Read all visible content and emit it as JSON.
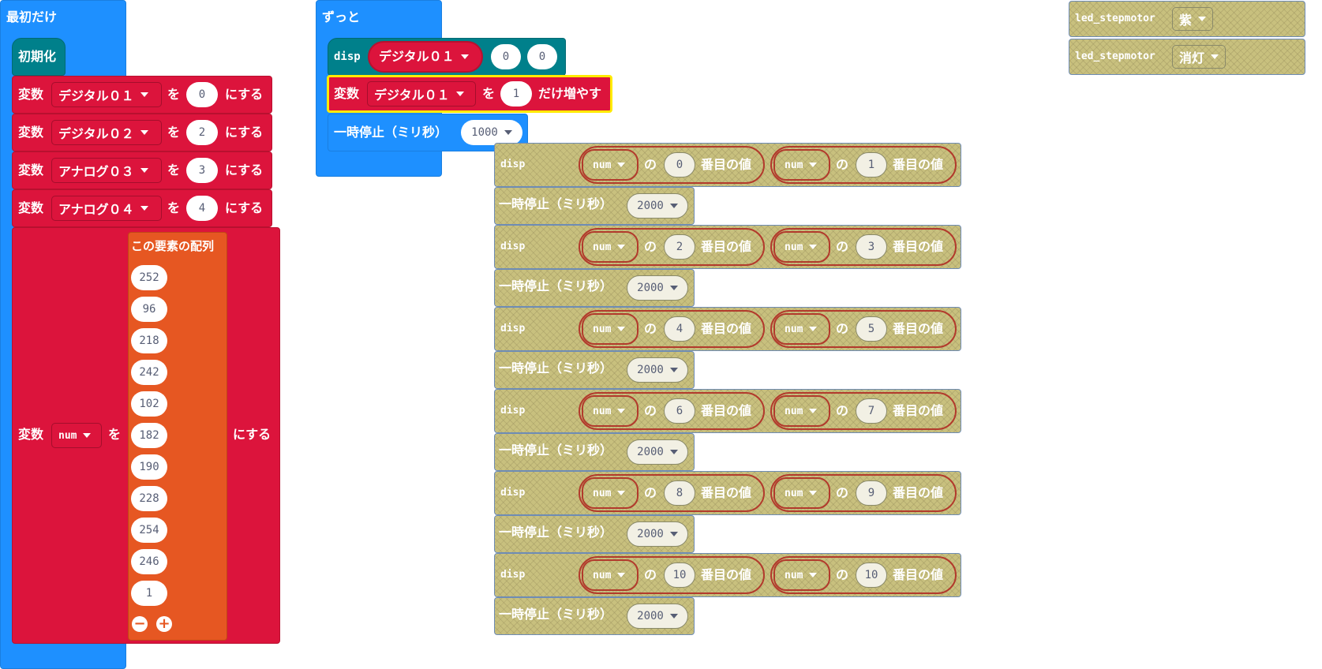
{
  "on_start": {
    "hat_label": "最初だけ",
    "init_label": "初期化",
    "set_rows": [
      {
        "prefix": "変数",
        "var": "デジタル０１",
        "wo": "を",
        "value": "0",
        "suffix": "にする"
      },
      {
        "prefix": "変数",
        "var": "デジタル０２",
        "wo": "を",
        "value": "2",
        "suffix": "にする"
      },
      {
        "prefix": "変数",
        "var": "アナログ０３",
        "wo": "を",
        "value": "3",
        "suffix": "にする"
      },
      {
        "prefix": "変数",
        "var": "アナログ０４",
        "wo": "を",
        "value": "4",
        "suffix": "にする"
      }
    ],
    "array_set": {
      "prefix": "変数",
      "var": "num",
      "wo": "を",
      "suffix": "にする",
      "array_label": "この要素の配列",
      "values": [
        "252",
        "96",
        "218",
        "242",
        "102",
        "182",
        "190",
        "228",
        "254",
        "246",
        "1"
      ]
    }
  },
  "forever": {
    "hat_label": "ずっと",
    "disp": {
      "label": "disp",
      "var": "デジタル０１",
      "a": "0",
      "b": "0"
    },
    "change": {
      "prefix": "変数",
      "var": "デジタル０１",
      "wo": "を",
      "value": "1",
      "suffix": "だけ増やす"
    },
    "pause": {
      "label": "一時停止（ミリ秒）",
      "value": "1000"
    }
  },
  "disabled_stack": {
    "rows": [
      {
        "label": "disp",
        "arr1": "num",
        "no1": "の",
        "i1": "0",
        "idx1": "番目の値",
        "arr2": "num",
        "no2": "の",
        "i2": "1",
        "idx2": "番目の値",
        "pause_label": "一時停止（ミリ秒）",
        "pause": "2000"
      },
      {
        "label": "disp",
        "arr1": "num",
        "no1": "の",
        "i1": "2",
        "idx1": "番目の値",
        "arr2": "num",
        "no2": "の",
        "i2": "3",
        "idx2": "番目の値",
        "pause_label": "一時停止（ミリ秒）",
        "pause": "2000"
      },
      {
        "label": "disp",
        "arr1": "num",
        "no1": "の",
        "i1": "4",
        "idx1": "番目の値",
        "arr2": "num",
        "no2": "の",
        "i2": "5",
        "idx2": "番目の値",
        "pause_label": "一時停止（ミリ秒）",
        "pause": "2000"
      },
      {
        "label": "disp",
        "arr1": "num",
        "no1": "の",
        "i1": "6",
        "idx1": "番目の値",
        "arr2": "num",
        "no2": "の",
        "i2": "7",
        "idx2": "番目の値",
        "pause_label": "一時停止（ミリ秒）",
        "pause": "2000"
      },
      {
        "label": "disp",
        "arr1": "num",
        "no1": "の",
        "i1": "8",
        "idx1": "番目の値",
        "arr2": "num",
        "no2": "の",
        "i2": "9",
        "idx2": "番目の値",
        "pause_label": "一時停止（ミリ秒）",
        "pause": "2000"
      },
      {
        "label": "disp",
        "arr1": "num",
        "no1": "の",
        "i1": "10",
        "idx1": "番目の値",
        "arr2": "num",
        "no2": "の",
        "i2": "10",
        "idx2": "番目の値",
        "pause_label": "一時停止（ミリ秒）",
        "pause": "2000"
      }
    ]
  },
  "stepmotor_blocks": [
    {
      "label": "led_stepmotor",
      "option": "紫"
    },
    {
      "label": "led_stepmotor",
      "option": "消灯"
    }
  ],
  "colors": {
    "events": "#1e90ff",
    "variables": "#dc143c",
    "custom": "#00808b",
    "arrays": "#e65722",
    "disabled": "#c8c07e",
    "highlight": "#ffeb00"
  }
}
